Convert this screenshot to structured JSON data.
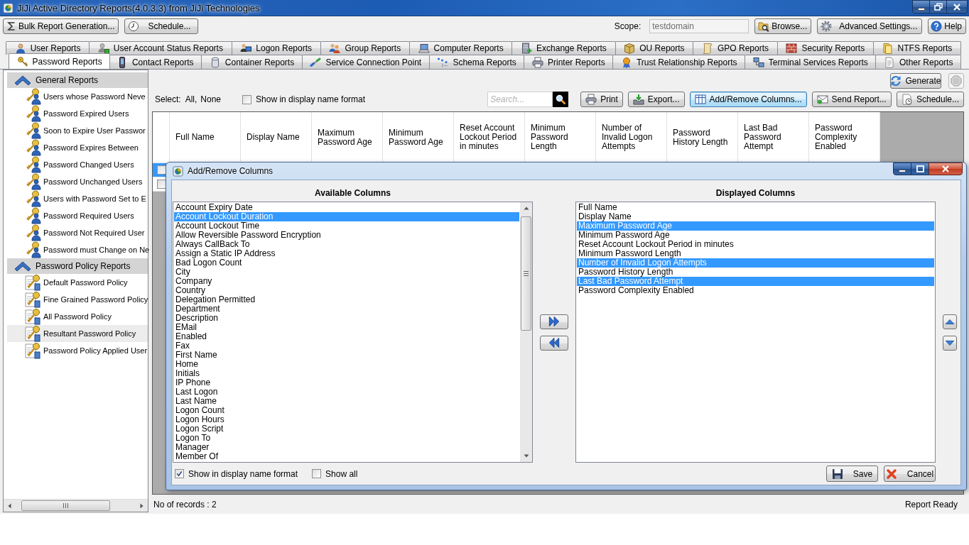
{
  "window": {
    "title": "JiJi Active Directory Reports(4.0.3.3) from JiJi Technologies"
  },
  "toolbar": {
    "bulk_button": {
      "label": "Bulk Report Generation..."
    },
    "schedule_button": {
      "label": "Schedule..."
    },
    "scope": {
      "label": "Scope:",
      "value": "testdomain"
    },
    "browse_button": {
      "label": "Browse..."
    },
    "settings_button": {
      "label": "Advanced Settings..."
    },
    "help_button": {
      "label": "Help"
    }
  },
  "tab_rows": [
    {
      "tabs": [
        {
          "label": "User Reports",
          "selected": false
        },
        {
          "label": "User Account Status Reports",
          "selected": false
        },
        {
          "label": "Logon Reports",
          "selected": false
        },
        {
          "label": "Group Reports",
          "selected": false
        },
        {
          "label": "Computer Reports",
          "selected": false
        },
        {
          "label": "Exchange Reports",
          "selected": false
        },
        {
          "label": "OU Reports",
          "selected": false
        },
        {
          "label": "GPO Reports",
          "selected": false
        },
        {
          "label": "Security Reports",
          "selected": false
        },
        {
          "label": "NTFS Reports",
          "selected": false
        }
      ]
    },
    {
      "tabs": [
        {
          "label": "Password Reports",
          "selected": true
        },
        {
          "label": "Contact Reports",
          "selected": false
        },
        {
          "label": "Container Reports",
          "selected": false
        },
        {
          "label": "Service Connection Point",
          "selected": false
        },
        {
          "label": "Schema Reports",
          "selected": false
        },
        {
          "label": "Printer Reports",
          "selected": false
        },
        {
          "label": "Trust Relationship Reports",
          "selected": false
        },
        {
          "label": "Terminal Services Reports",
          "selected": false
        },
        {
          "label": "Other Reports",
          "selected": false
        }
      ]
    }
  ],
  "sidebar": {
    "groups": [
      {
        "label": "General Reports",
        "expanded": true,
        "items": [
          {
            "label": "Users whose Password Neve",
            "selected": false
          },
          {
            "label": "Password Expired Users",
            "selected": false
          },
          {
            "label": "Soon to Expire User Passwor",
            "selected": false
          },
          {
            "label": "Password Expires Between",
            "selected": false
          },
          {
            "label": "Password Changed Users",
            "selected": false
          },
          {
            "label": "Password Unchanged Users",
            "selected": false
          },
          {
            "label": "Users with Password Set to E",
            "selected": false
          },
          {
            "label": "Password Required Users",
            "selected": false
          },
          {
            "label": "Password Not Required User",
            "selected": false
          },
          {
            "label": "Password must Change on Ne",
            "selected": false
          }
        ]
      },
      {
        "label": "Password Policy Reports",
        "expanded": true,
        "items": [
          {
            "label": "Default Password Policy",
            "selected": false
          },
          {
            "label": "Fine Grained Password Policy",
            "selected": false
          },
          {
            "label": "All Password Policy",
            "selected": false
          },
          {
            "label": "Resultant Password Policy",
            "selected": true
          },
          {
            "label": "Password Policy Applied User",
            "selected": false
          }
        ]
      }
    ]
  },
  "report_panel": {
    "generate_button": {
      "label": "Generate"
    },
    "stop_button": {
      "disabled": true
    },
    "select": {
      "label": "Select:",
      "links": [
        "All,",
        "None"
      ]
    },
    "display_name_option": {
      "label": "Show in display name format",
      "checked": false
    },
    "search": {
      "placeholder": "Search..."
    },
    "actions": [
      {
        "label": "Print",
        "focused": false
      },
      {
        "label": "Export...",
        "focused": false
      },
      {
        "label": "Add/Remove Columns...",
        "focused": true
      },
      {
        "label": "Send Report...",
        "focused": false
      },
      {
        "label": "Schedule...",
        "focused": false
      }
    ]
  },
  "table": {
    "columns": [
      "Full Name",
      "Display Name",
      "Maximum Password Age",
      "Minimum Password Age",
      "Reset Account Lockout Period in minutes",
      "Minimum Password Length",
      "Number of Invalid Logon Attempts",
      "Password History Length",
      "Last Bad Password Attempt",
      "Password Complexity Enabled"
    ],
    "rows": [
      {
        "selected": true,
        "checked": false
      },
      {
        "selected": false,
        "checked": false
      }
    ]
  },
  "status_bar": {
    "records": "No of records : 2",
    "status": "Report Ready"
  },
  "dialog": {
    "title": "Add/Remove Columns",
    "available": {
      "heading": "Available Columns",
      "items": [
        {
          "label": "Account Expiry Date",
          "selected": false
        },
        {
          "label": "Account Lockout Duration",
          "selected": true
        },
        {
          "label": "Account Lockout Time",
          "selected": false
        },
        {
          "label": "Allow Reversible Password Encryption",
          "selected": false
        },
        {
          "label": "Always CallBack To",
          "selected": false
        },
        {
          "label": "Assign a Static IP Address",
          "selected": false
        },
        {
          "label": "Bad Logon Count",
          "selected": false
        },
        {
          "label": "City",
          "selected": false
        },
        {
          "label": "Company",
          "selected": false
        },
        {
          "label": "Country",
          "selected": false
        },
        {
          "label": "Delegation Permitted",
          "selected": false
        },
        {
          "label": "Department",
          "selected": false
        },
        {
          "label": "Description",
          "selected": false
        },
        {
          "label": "EMail",
          "selected": false
        },
        {
          "label": "Enabled",
          "selected": false
        },
        {
          "label": "Fax",
          "selected": false
        },
        {
          "label": "First Name",
          "selected": false
        },
        {
          "label": "Home",
          "selected": false
        },
        {
          "label": "Initials",
          "selected": false
        },
        {
          "label": "IP Phone",
          "selected": false
        },
        {
          "label": "Last Logon",
          "selected": false
        },
        {
          "label": "Last Name",
          "selected": false
        },
        {
          "label": "Logon Count",
          "selected": false
        },
        {
          "label": "Logon Hours",
          "selected": false
        },
        {
          "label": "Logon Script",
          "selected": false
        },
        {
          "label": "Logon To",
          "selected": false
        },
        {
          "label": "Manager",
          "selected": false
        },
        {
          "label": "Member Of",
          "selected": false
        }
      ]
    },
    "displayed": {
      "heading": "Displayed Columns",
      "items": [
        {
          "label": "Full Name",
          "selected": false
        },
        {
          "label": "Display Name",
          "selected": false
        },
        {
          "label": "Maximum Password Age",
          "selected": true
        },
        {
          "label": "Minimum Password Age",
          "selected": false
        },
        {
          "label": "Reset Account Lockout Period in minutes",
          "selected": false
        },
        {
          "label": "Minimum Password Length",
          "selected": false
        },
        {
          "label": "Number of Invalid Logon Attempts",
          "selected": true
        },
        {
          "label": "Password History Length",
          "selected": false
        },
        {
          "label": "Last Bad Password Attempt",
          "selected": true
        },
        {
          "label": "Password Complexity Enabled",
          "selected": false
        }
      ]
    },
    "options": [
      {
        "label": "Show in display name format",
        "checked": true
      },
      {
        "label": "Show all",
        "checked": false
      }
    ],
    "save_button": {
      "label": "Save"
    },
    "cancel_button": {
      "label": "Cancel"
    }
  }
}
